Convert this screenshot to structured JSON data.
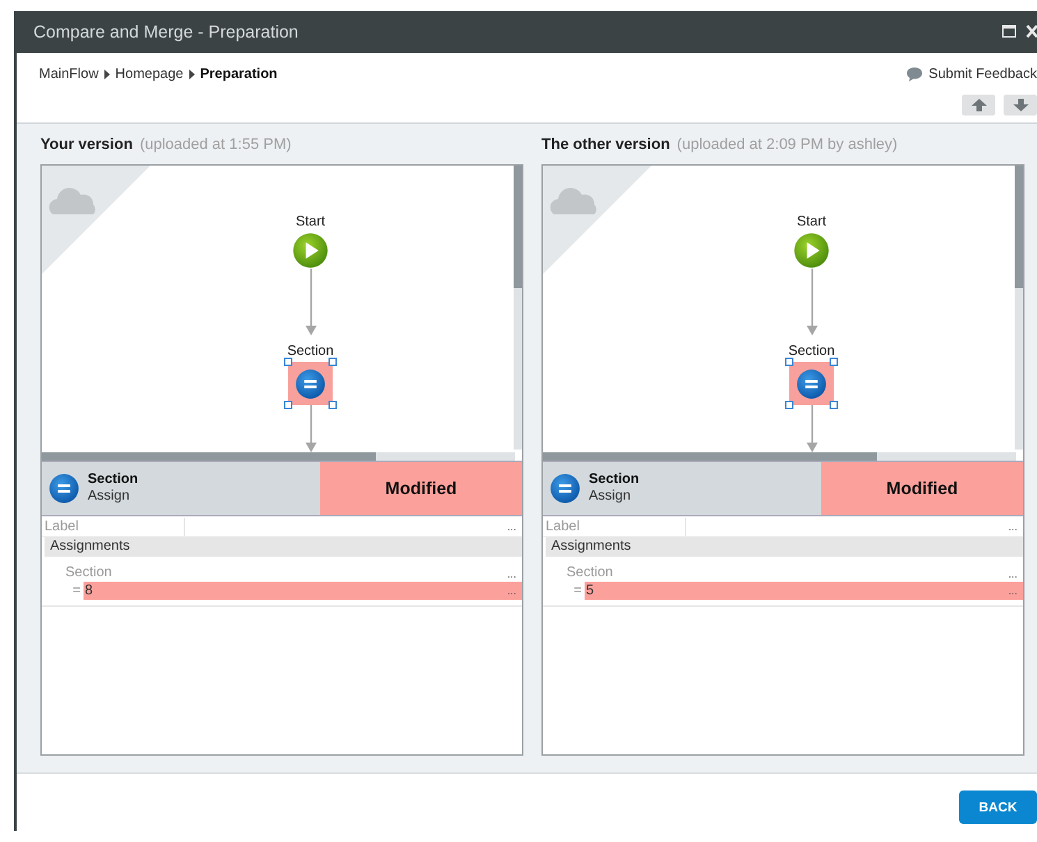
{
  "window": {
    "title": "Compare and Merge - Preparation"
  },
  "breadcrumb": [
    {
      "label": "MainFlow",
      "current": false
    },
    {
      "label": "Homepage",
      "current": false
    },
    {
      "label": "Preparation",
      "current": true
    }
  ],
  "feedback_link": "Submit Feedback",
  "panels": [
    {
      "title": "Your version",
      "subtitle": "(uploaded at 1:55 PM)",
      "nodes": [
        {
          "kind": "start",
          "label": "Start",
          "modified": false,
          "selected": false
        },
        {
          "kind": "assign",
          "label": "Section",
          "modified": true,
          "selected": true
        }
      ],
      "element": {
        "kind": "assign",
        "name": "Section",
        "type": "Assign",
        "status": "Modified"
      },
      "properties": [
        {
          "kind": "field",
          "label": "Label",
          "button": "..."
        },
        {
          "kind": "group",
          "label": "Assignments"
        },
        {
          "kind": "assignment",
          "variable": "Section",
          "variable_button": "...",
          "operator": "=",
          "value": "8",
          "value_button": "...",
          "modified": true
        }
      ]
    },
    {
      "title": "The other version",
      "subtitle": "(uploaded at 2:09 PM by ashley)",
      "nodes": [
        {
          "kind": "start",
          "label": "Start",
          "modified": false,
          "selected": false
        },
        {
          "kind": "assign",
          "label": "Section",
          "modified": true,
          "selected": true
        }
      ],
      "element": {
        "kind": "assign",
        "name": "Section",
        "type": "Assign",
        "status": "Modified"
      },
      "properties": [
        {
          "kind": "field",
          "label": "Label",
          "button": "..."
        },
        {
          "kind": "group",
          "label": "Assignments"
        },
        {
          "kind": "assignment",
          "variable": "Section",
          "variable_button": "...",
          "operator": "=",
          "value": "5",
          "value_button": "...",
          "modified": true
        }
      ]
    }
  ],
  "buttons": [
    {
      "label": "BACK"
    }
  ]
}
